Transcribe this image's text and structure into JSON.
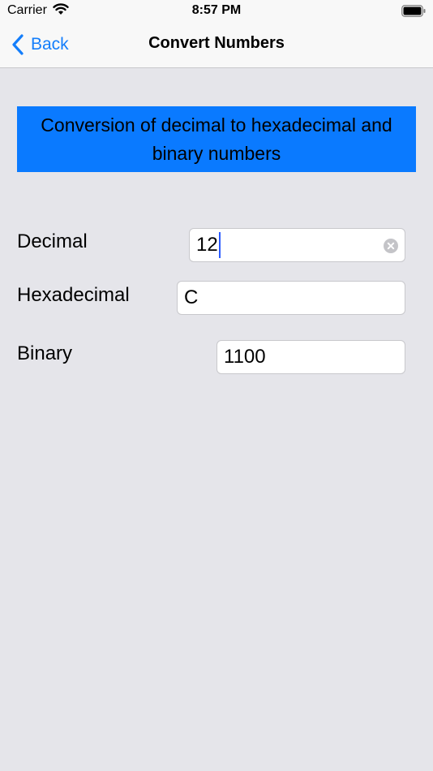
{
  "status_bar": {
    "carrier": "Carrier",
    "time": "8:57 PM",
    "wifi_icon": "wifi-icon",
    "battery_icon": "battery-icon"
  },
  "nav": {
    "back_label": "Back",
    "back_icon": "chevron-left-icon",
    "title": "Convert Numbers"
  },
  "banner": {
    "text": "Conversion of decimal to hexadecimal and binary numbers"
  },
  "fields": {
    "decimal": {
      "label": "Decimal",
      "value": "12",
      "clear_icon": "clear-icon"
    },
    "hexadecimal": {
      "label": "Hexadecimal",
      "value": "C"
    },
    "binary": {
      "label": "Binary",
      "value": "1100"
    }
  },
  "colors": {
    "accent": "#147efb",
    "banner": "#0a7aff",
    "background": "#e5e5ea",
    "cursor": "#2b5bff"
  }
}
